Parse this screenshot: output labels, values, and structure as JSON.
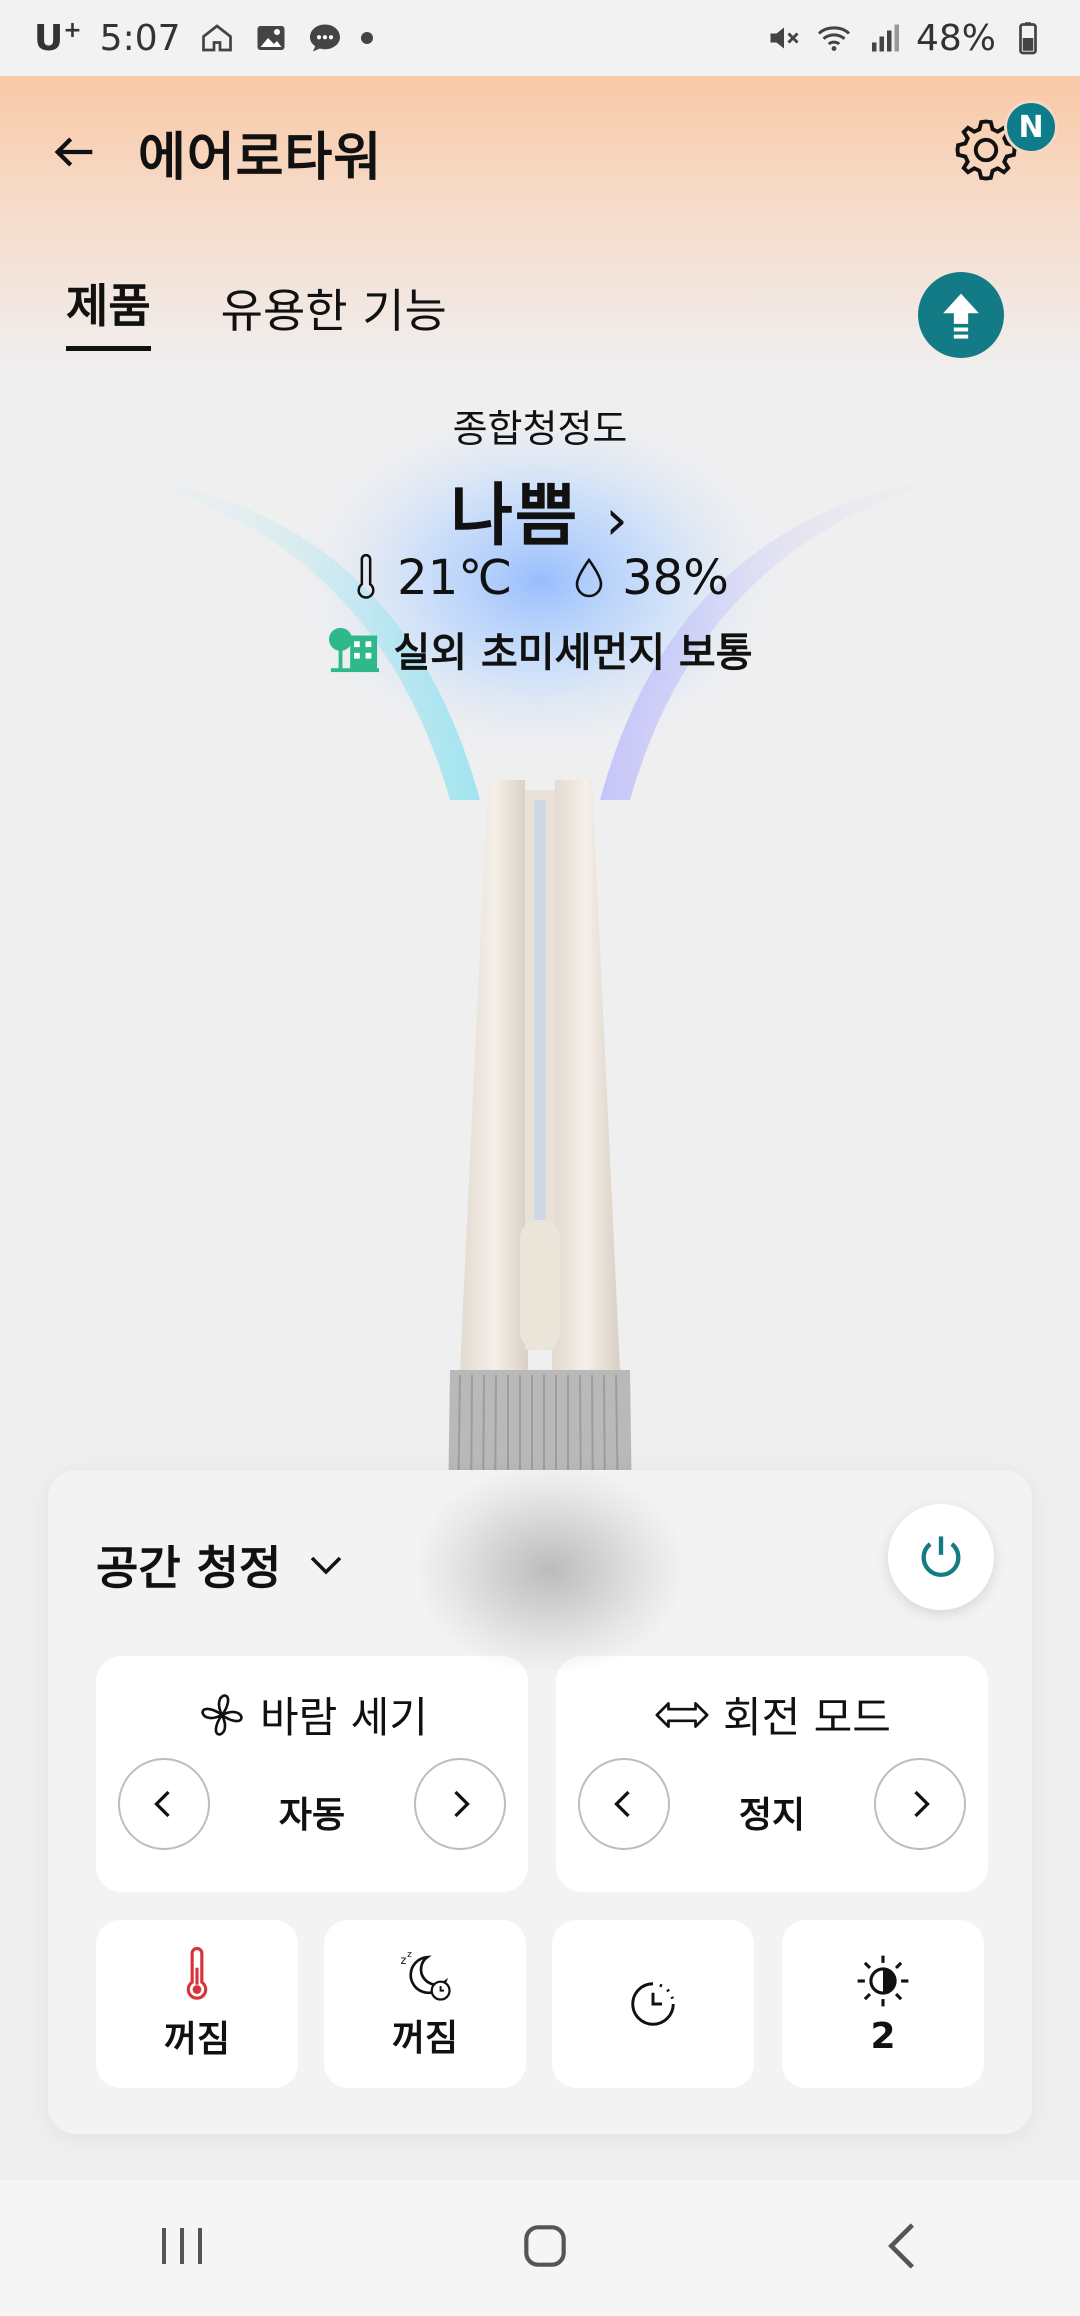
{
  "status": {
    "carrier": "U",
    "carrier_sup": "+",
    "time": "5:07",
    "battery": "48%"
  },
  "header": {
    "title": "에어로타워",
    "notification_badge": "N"
  },
  "tabs": [
    {
      "label": "제품",
      "active": true
    },
    {
      "label": "유용한 기능",
      "active": false
    }
  ],
  "air": {
    "quality_label": "종합청정도",
    "quality_value": "나쁨",
    "temperature": "21℃",
    "humidity": "38%",
    "outdoor": "실외 초미세먼지 보통"
  },
  "controls": {
    "mode": "공간 청정",
    "wind": {
      "title": "바람 세기",
      "value": "자동"
    },
    "rotation": {
      "title": "회전 모드",
      "value": "정지"
    },
    "quick": [
      {
        "icon": "thermometer-icon",
        "value": "꺼짐"
      },
      {
        "icon": "sleep-icon",
        "value": "꺼짐"
      },
      {
        "icon": "timer-icon",
        "value": ""
      },
      {
        "icon": "brightness-icon",
        "value": "2"
      }
    ]
  },
  "colors": {
    "accent": "#137b85",
    "header_gradient": "#f9c9a6",
    "red": "#d6333b"
  }
}
